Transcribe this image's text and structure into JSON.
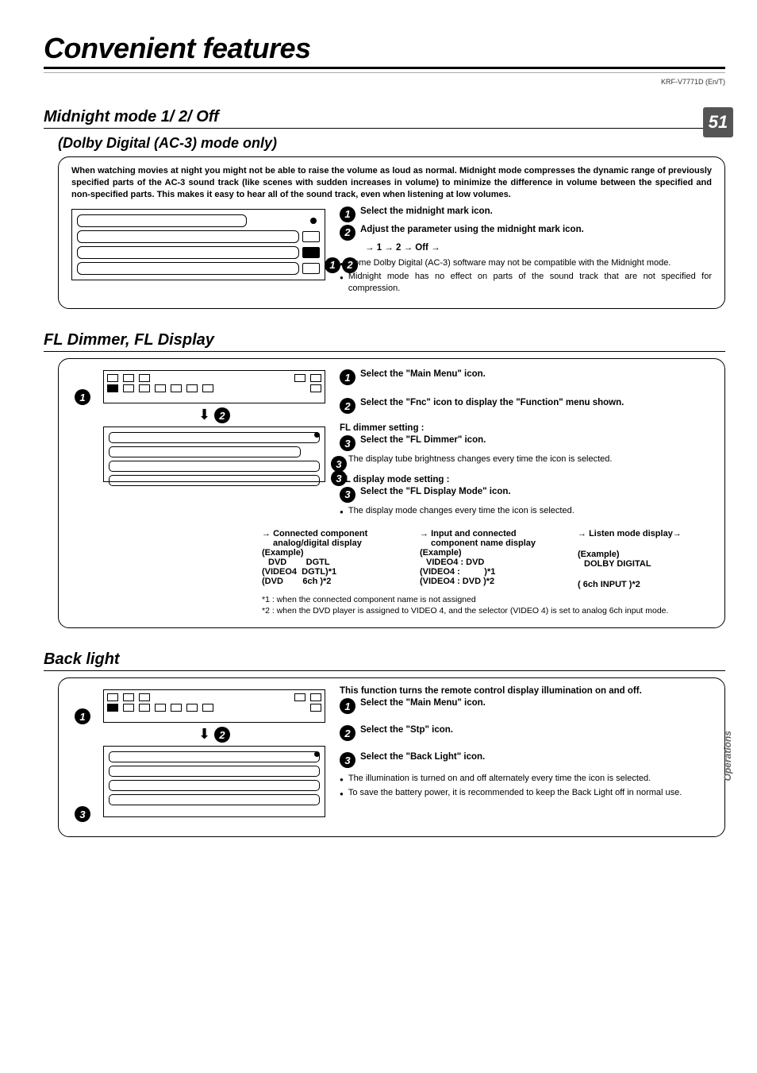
{
  "doc_id": "KRF-V7771D (En/T)",
  "page_number": "51",
  "side_tab": "Operations",
  "page_title": "Convenient features",
  "midnight": {
    "heading": "Midnight mode 1/ 2/ Off",
    "subheading": "(Dolby Digital (AC-3) mode only)",
    "intro": "When watching movies at night you might not be able to raise the volume as loud as normal. Midnight mode compresses the dynamic range of previously specified parts of the AC-3 sound track (like scenes with sudden increases in volume) to minimize the difference in volume between the specified and non-specified parts. This makes it easy to hear all of the sound track, even when listening at low volumes.",
    "step1": "Select the midnight mark icon.",
    "step2": "Adjust the parameter using the midnight mark icon.",
    "sequence": "→ 1 → 2 → Off →",
    "note1": "Some Dolby Digital (AC-3) software may not be compatible with the Midnight mode.",
    "note2": "Midnight mode has no effect on parts of the sound track that are not specified for compression."
  },
  "fl": {
    "heading": "FL Dimmer, FL Display",
    "step1": "Select the \"Main Menu\" icon.",
    "step2": "Select the \"Fnc\" icon to display the \"Function\" menu shown.",
    "dimmer_head": "FL dimmer setting :",
    "step3a": "Select the \"FL Dimmer\" icon.",
    "dimmer_note": "The display tube brightness changes every time the icon is selected.",
    "display_head": "FL display mode setting :",
    "step3b": "Select the \"FL Display Mode\" icon.",
    "display_note": "The display mode changes every time the icon is selected.",
    "col1_h1": "Connected component",
    "col1_h2": "analog/digital display",
    "example_label": "(Example)",
    "col1_l1": "DVD        DGTL",
    "col1_l2": "(VIDEO4  DGTL)*1",
    "col1_l3": "(DVD        6ch )*2",
    "col2_h1": "Input and connected",
    "col2_h2": "component name display",
    "col2_l1": "VIDEO4 : DVD",
    "col2_l2": "(VIDEO4 :          )*1",
    "col2_l3": "(VIDEO4 : DVD )*2",
    "col3_h1": "Listen mode display→",
    "col3_l1": "DOLBY DIGITAL",
    "col3_l3": "( 6ch INPUT )*2",
    "footnote1": "*1 : when the connected component name is not assigned",
    "footnote2": "*2 : when the DVD player is assigned to VIDEO 4, and the selector (VIDEO 4) is set to analog 6ch input mode."
  },
  "backlight": {
    "heading": "Back light",
    "intro": "This function turns the remote control display illumination on and off.",
    "step1": "Select the \"Main Menu\" icon.",
    "step2": "Select the \"Stp\" icon.",
    "step3": "Select the \"Back Light\" icon.",
    "note1": "The illumination is turned on and off alternately every time the icon is selected.",
    "note2": "To save the battery power, it is recommended to keep the Back Light off in normal use."
  }
}
